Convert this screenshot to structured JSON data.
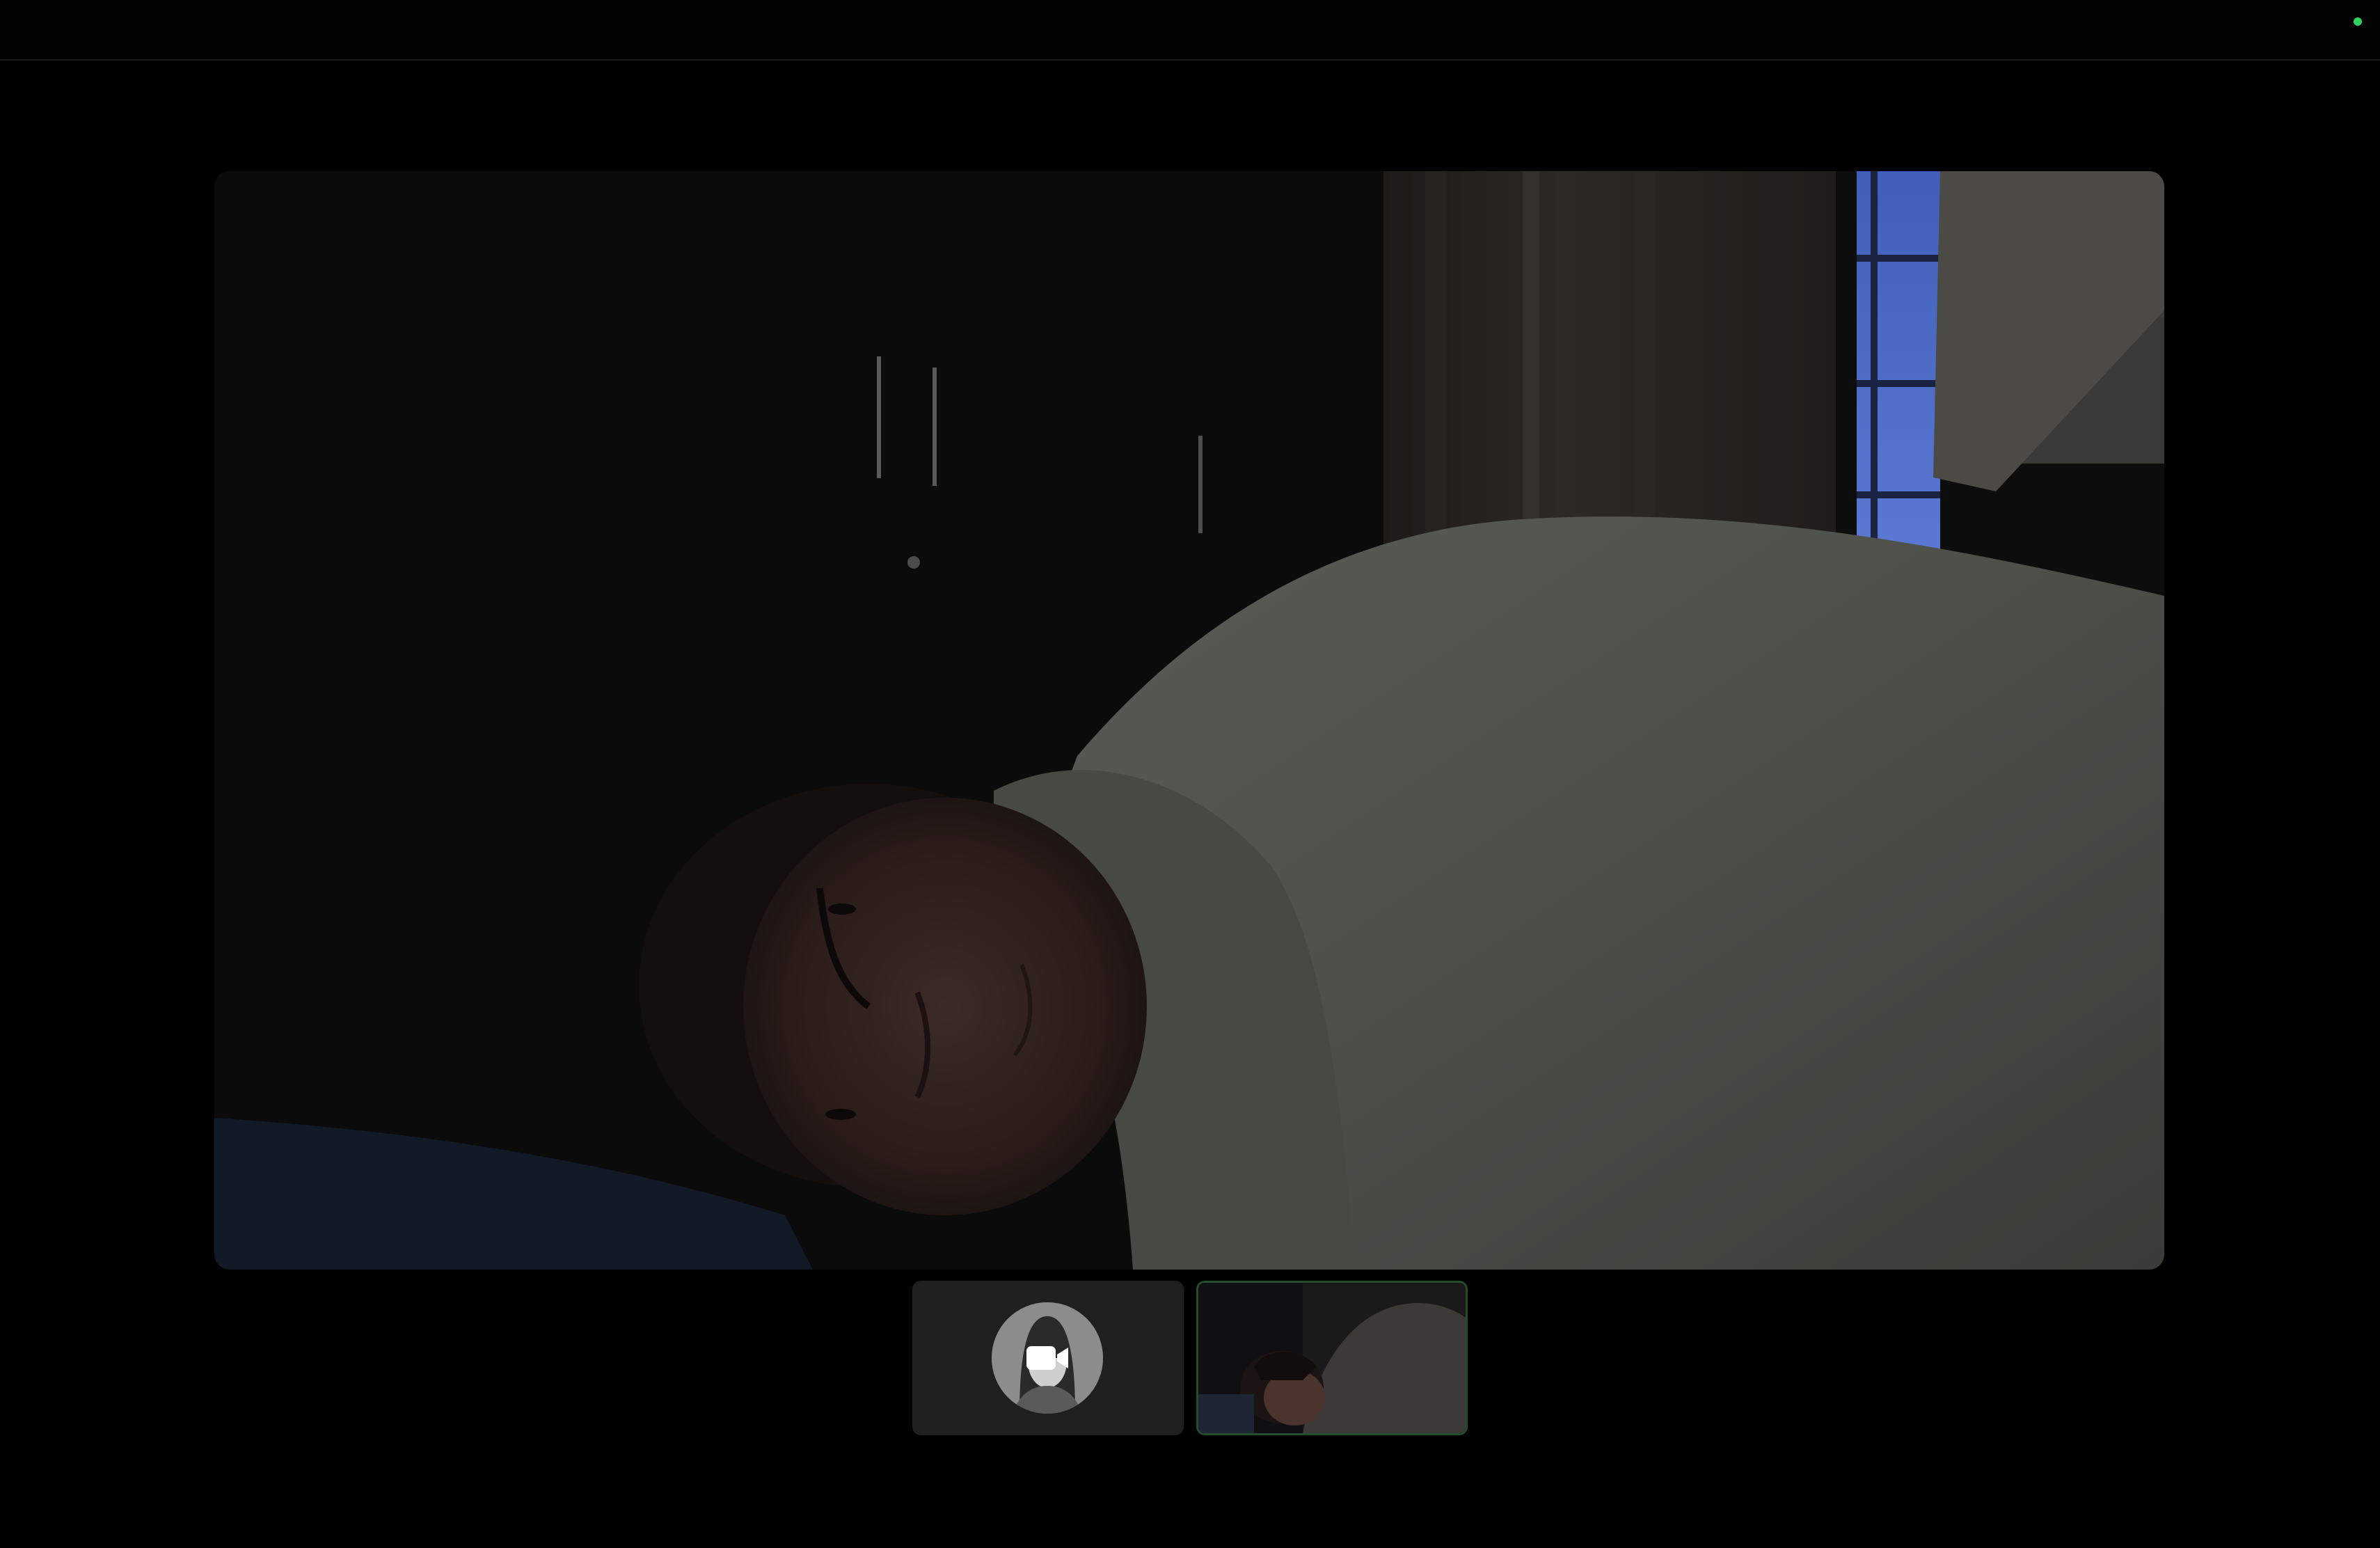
{
  "window": {
    "status_indicator_color": "#2fd35a"
  },
  "main_video": {
    "description_icon": "participant-video-feed"
  },
  "participants": [
    {
      "icon": "camera-off-icon",
      "avatar": "avatar-illustration"
    },
    {
      "icon": "participant-video-thumbnail",
      "active_border_color": "#234d2b"
    }
  ]
}
